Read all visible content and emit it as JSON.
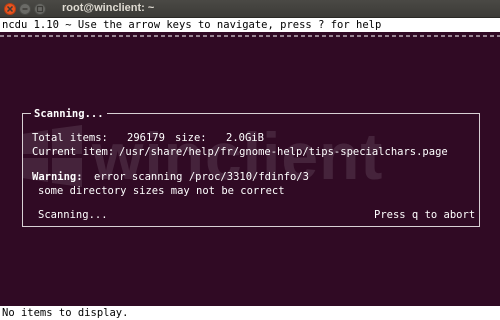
{
  "window": {
    "title": "root@winclient: ~"
  },
  "ncdu": {
    "header": "ncdu 1.10 ~ Use the arrow keys to navigate, press ? for help",
    "status": "No items to display."
  },
  "dialog": {
    "title": "Scanning...",
    "total_items_label": "Total items:",
    "total_items_value": "296179",
    "size_label": "size:",
    "size_value": "2.0GiB",
    "current_item_label": "Current item:",
    "current_item_value": "/usr/share/help/fr/gnome-help/tips-specialchars.page",
    "warning_label": "Warning:",
    "warning_text": "error scanning /proc/3310/fdinfo/3",
    "warning_note": "some directory sizes may not be correct",
    "scanning_status": "Scanning...",
    "abort_hint": "Press q to abort"
  },
  "watermark": {
    "text": "winclient"
  },
  "colors": {
    "terminal_bg": "#300a24",
    "close_button": "#e95420",
    "bar_bg": "#ffffff"
  },
  "icons": {
    "close": "close-icon",
    "minimize": "minimize-icon",
    "maximize": "maximize-icon",
    "watermark": "windows-logo-icon"
  }
}
